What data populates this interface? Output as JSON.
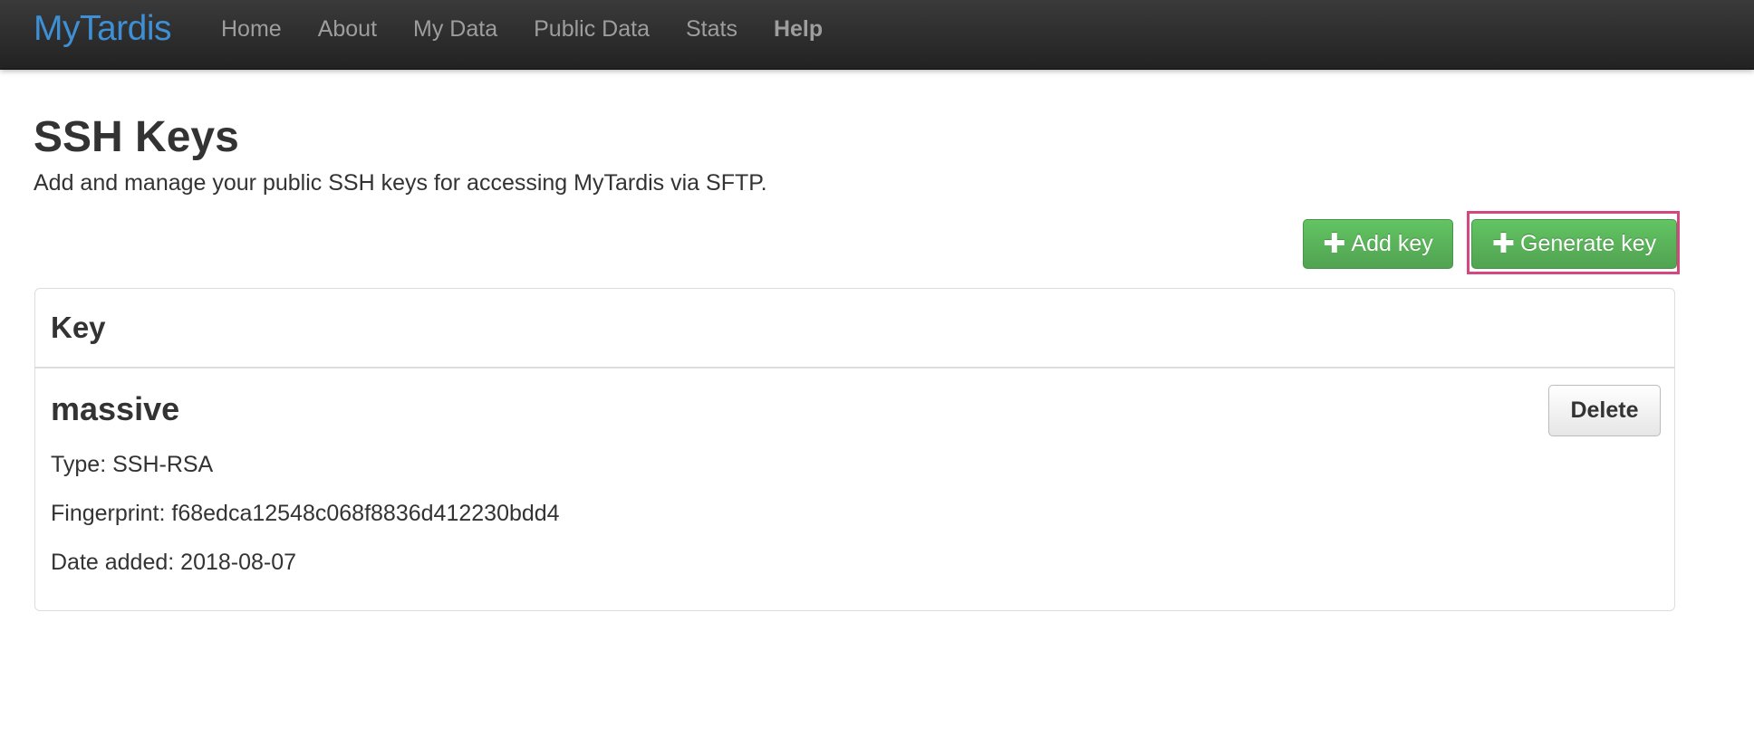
{
  "navbar": {
    "brand": "MyTardis",
    "items": [
      {
        "label": "Home"
      },
      {
        "label": "About"
      },
      {
        "label": "My Data"
      },
      {
        "label": "Public Data"
      },
      {
        "label": "Stats"
      },
      {
        "label": "Help"
      }
    ]
  },
  "page": {
    "title": "SSH Keys",
    "subtitle": "Add and manage your public SSH keys for accessing MyTardis via SFTP."
  },
  "actions": {
    "add_key_label": "Add key",
    "generate_key_label": "Generate key",
    "plus_icon": "plus-icon",
    "highlight_color": "#d5477f",
    "button_color": "#5bb75b"
  },
  "panel": {
    "header": "Key",
    "keys": [
      {
        "name": "massive",
        "type_line": "Type: SSH-RSA",
        "fingerprint_line": "Fingerprint: f68edca12548c068f8836d412230bdd4",
        "date_line": "Date added: 2018-08-07",
        "delete_label": "Delete"
      }
    ]
  },
  "colors": {
    "brand": "#3e8fd4",
    "navbar_bg": "#2b2b2b",
    "nav_text": "#9d9d9d"
  }
}
